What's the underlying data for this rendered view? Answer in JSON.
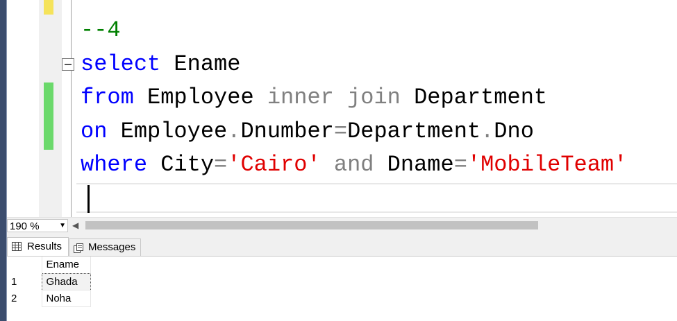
{
  "editor": {
    "lines": [
      [
        {
          "t": "--4",
          "c": "cmt"
        }
      ],
      [
        {
          "t": "select",
          "c": "kw"
        },
        {
          "t": " Ename",
          "c": "id"
        }
      ],
      [
        {
          "t": "from",
          "c": "kw"
        },
        {
          "t": " Employee ",
          "c": "id"
        },
        {
          "t": "inner join",
          "c": "gray"
        },
        {
          "t": " Department",
          "c": "id"
        }
      ],
      [
        {
          "t": "on",
          "c": "kw"
        },
        {
          "t": " Employee",
          "c": "id"
        },
        {
          "t": ".",
          "c": "gray"
        },
        {
          "t": "Dnumber",
          "c": "id"
        },
        {
          "t": "=",
          "c": "gray"
        },
        {
          "t": "Department",
          "c": "id"
        },
        {
          "t": ".",
          "c": "gray"
        },
        {
          "t": "Dno",
          "c": "id"
        }
      ],
      [
        {
          "t": "where",
          "c": "kw"
        },
        {
          "t": " City",
          "c": "id"
        },
        {
          "t": "=",
          "c": "gray"
        },
        {
          "t": "'Cairo'",
          "c": "str"
        },
        {
          "t": " and ",
          "c": "gray"
        },
        {
          "t": "Dname",
          "c": "id"
        },
        {
          "t": "=",
          "c": "gray"
        },
        {
          "t": "'MobileTeam'",
          "c": "str"
        }
      ],
      []
    ],
    "colors": {
      "keyword": "#0000ff",
      "comment": "#008000",
      "string": "#e00000",
      "operator": "#808080",
      "change_saved": "#6bd96b",
      "change_unsaved": "#f5e35a"
    }
  },
  "statusbar": {
    "zoom": "190 %",
    "zoom_dropdown_icon": "chevron-down-icon",
    "scroll_left_icon": "triangle-left-icon"
  },
  "results_pane": {
    "tabs": [
      {
        "label": "Results",
        "icon": "grid-icon",
        "active": true
      },
      {
        "label": "Messages",
        "icon": "messages-icon",
        "active": false
      }
    ],
    "grid": {
      "columns": [
        "Ename"
      ],
      "rows": [
        {
          "num": "1",
          "values": [
            "Ghada"
          ]
        },
        {
          "num": "2",
          "values": [
            "Noha"
          ]
        }
      ]
    }
  }
}
